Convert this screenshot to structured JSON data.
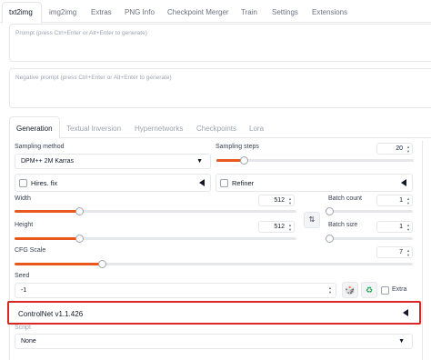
{
  "top_tabs": [
    "txt2img",
    "img2img",
    "Extras",
    "PNG Info",
    "Checkpoint Merger",
    "Train",
    "Settings",
    "Extensions"
  ],
  "prompt": {
    "placeholder": "Prompt (press Ctrl+Enter or Alt+Enter to generate)"
  },
  "negative_prompt": {
    "placeholder": "Negative prompt (press Ctrl+Enter or Alt+Enter to generate)"
  },
  "sub_tabs": [
    "Generation",
    "Textual Inversion",
    "Hypernetworks",
    "Checkpoints",
    "Lora"
  ],
  "sampling_method": {
    "label": "Sampling method",
    "value": "DPM++ 2M Karras",
    "caret": "▼"
  },
  "sampling_steps": {
    "label": "Sampling steps",
    "value": "20",
    "fraction": 0.14
  },
  "hires_fix": {
    "label": "Hires. fix"
  },
  "refiner": {
    "label": "Refiner"
  },
  "width": {
    "label": "Width",
    "value": "512",
    "fraction": 0.23
  },
  "height": {
    "label": "Height",
    "value": "512",
    "fraction": 0.23
  },
  "batch_count": {
    "label": "Batch count",
    "value": "1",
    "fraction": 0.0
  },
  "batch_size": {
    "label": "Batch size",
    "value": "1",
    "fraction": 0.0
  },
  "swap_icon": "⇅",
  "cfg_scale": {
    "label": "CFG Scale",
    "value": "7",
    "fraction": 0.22
  },
  "seed": {
    "label": "Seed",
    "value": "-1",
    "extra_label": "Extra"
  },
  "dice_icon": "🎲",
  "recycle_icon": "♻",
  "controlnet": {
    "label": "ControlNet v1.1.426"
  },
  "script": {
    "label": "Script",
    "value": "None",
    "caret": "▼"
  },
  "spin_glyph": "▲\n▼",
  "colors": {
    "accent": "#e8581d",
    "highlight_border": "#dc2626"
  }
}
